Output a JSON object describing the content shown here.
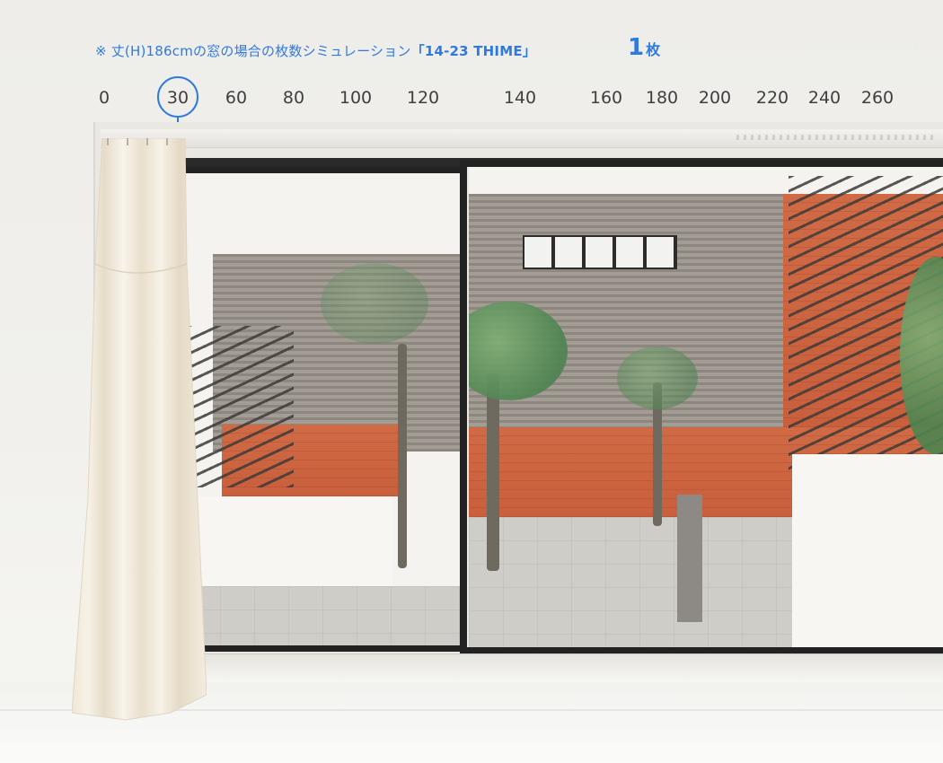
{
  "caption": {
    "prefix": "※ 丈(H)186cmの窓の場合の枚数シミュレーション",
    "product": "「14-23 THIME」"
  },
  "count": {
    "value": "1",
    "unit": "枚"
  },
  "ruler": {
    "ticks": [
      "0",
      "30",
      "60",
      "80",
      "100",
      "120",
      "140",
      "160",
      "180",
      "200",
      "220",
      "240",
      "260"
    ],
    "selected": "30"
  },
  "colors": {
    "accent": "#2f7ae0",
    "frame": "#222222",
    "curtain": "#f3ede0"
  }
}
